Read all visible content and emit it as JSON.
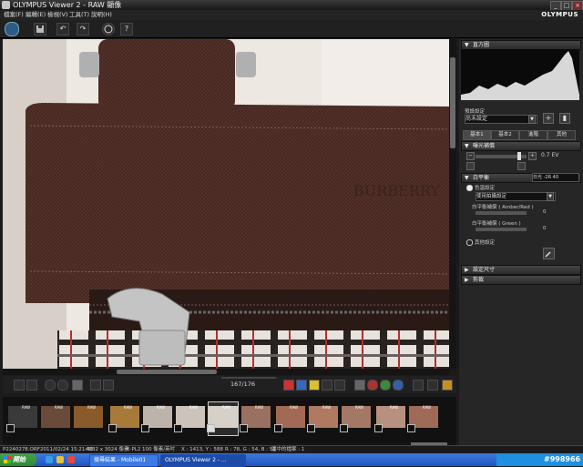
{
  "window": {
    "title": "OLYMPUS Viewer 2 - RAW 顯像",
    "controls": [
      "_",
      "□",
      "×"
    ]
  },
  "menu": {
    "items": [
      "檔案(F)",
      "編輯(E)",
      "檢視(V)",
      "工具(T)",
      "說明(H)"
    ],
    "brand": "OLYMPUS"
  },
  "toolbar": {
    "undo_icon": "↶",
    "redo_icon": "↷",
    "help_label": "?"
  },
  "viewer": {
    "frame_counter": "167/176"
  },
  "filmstrip": {
    "raw_tag": "RAW"
  },
  "panel": {
    "histogram_title": "直方圖",
    "preset_label": "預設設定",
    "preset_value": "尚未設定",
    "tabs": [
      "基本1",
      "基本2",
      "進階",
      "其他"
    ],
    "exposure_title": "曝光補償",
    "exposure_value": "0.7 EV",
    "wb_title": "白平衡",
    "wb_readout": "日光 -2R 40",
    "wb_color_label": "色溫設定",
    "wb_mode_value": "使用拍攝設定",
    "wb_amber_label": "白平衡補償 ( Amber/Red )",
    "wb_amber_value": "0",
    "wb_green_label": "白平衡補償 ( Green )",
    "wb_green_value": "0",
    "wb_custom_label": "其他設定",
    "size_title": "設定尺寸",
    "crop_title": "剪裁"
  },
  "statusbar": {
    "file": "P2240278.ORF",
    "datetime": "2011/02/24 15:21:40",
    "dimensions": "4032 x 3024 像素",
    "camera": "E-PL2",
    "iso": "100 像素/英吋",
    "coords": "X : 1413, Y : 588",
    "rgb": "R : 78, G : 54, B : 51",
    "selected": "選中的檔案 : 1"
  },
  "taskbar": {
    "start_label": "開始",
    "tasks": [
      "搜尋結果 - Mobile01",
      "OLYMPUS Viewer 2 - ..."
    ],
    "watermark": "#998966"
  },
  "colors": {
    "accent": "#2253c6",
    "leather": "#4a2a22"
  }
}
